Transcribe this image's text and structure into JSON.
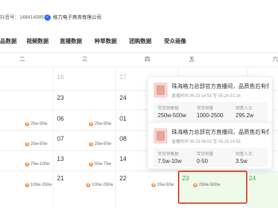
{
  "account": {
    "label": "抖音号：1484140851",
    "company": "格力电子商务有限公司"
  },
  "tabs": [
    "品数据",
    "视频数据",
    "直播数据",
    "种草数据",
    "团购数据",
    "受众画像"
  ],
  "weekdays": [
    "二",
    "三",
    "四",
    "五",
    "六"
  ],
  "days": [
    {
      "t": "16",
      "gray": true
    },
    {
      "t": "17",
      "gray": true
    },
    {
      "t": "23"
    },
    {
      "t": "24"
    },
    {
      "t": "06"
    },
    {
      "t": "07"
    },
    {
      "t": "01"
    },
    {
      "t": "13"
    },
    {
      "t": "14"
    },
    {
      "t": "08"
    },
    {
      "t": "21"
    },
    {
      "t": "22"
    },
    {
      "t": "23",
      "green": true
    },
    {
      "t": "24",
      "green": true
    }
  ],
  "pills": [
    "25w-50w",
    "25w-50w",
    "25w-50w",
    "25w-50w",
    "25w-50w",
    "25w-50w",
    "75w-100w",
    "50w-75w",
    "25w-50w",
    "100w-250w",
    "100w-250w",
    "25w-50w",
    "250w-500w"
  ],
  "live_cards": [
    {
      "title": "珠海格力总部官方直播间，品质售后有保障，",
      "time": "直播时间 05-23 14:55 至 05-24 01:16",
      "stats": [
        {
          "label": "带货销售额",
          "value": "250w-500w"
        },
        {
          "label": "带货销量",
          "value": "1000-2500"
        },
        {
          "label": "观看人次",
          "value": "295.2w"
        }
      ]
    },
    {
      "title": "珠海格力总部官方直播间，品质售后有保障，",
      "time": "直播时间 05-23 06:02 至 05-23 14:55",
      "stats": [
        {
          "label": "带货销售额",
          "value": "7.5w-10w"
        },
        {
          "label": "带货销量",
          "value": "0-50"
        },
        {
          "label": "观看人次",
          "value": "3.5w"
        }
      ]
    }
  ],
  "colors": {
    "accent_orange": "#f08a3c",
    "highlight_red": "#e0493a",
    "highlight_green_bg": "#eefaea",
    "verify_blue": "#2a6df4"
  }
}
